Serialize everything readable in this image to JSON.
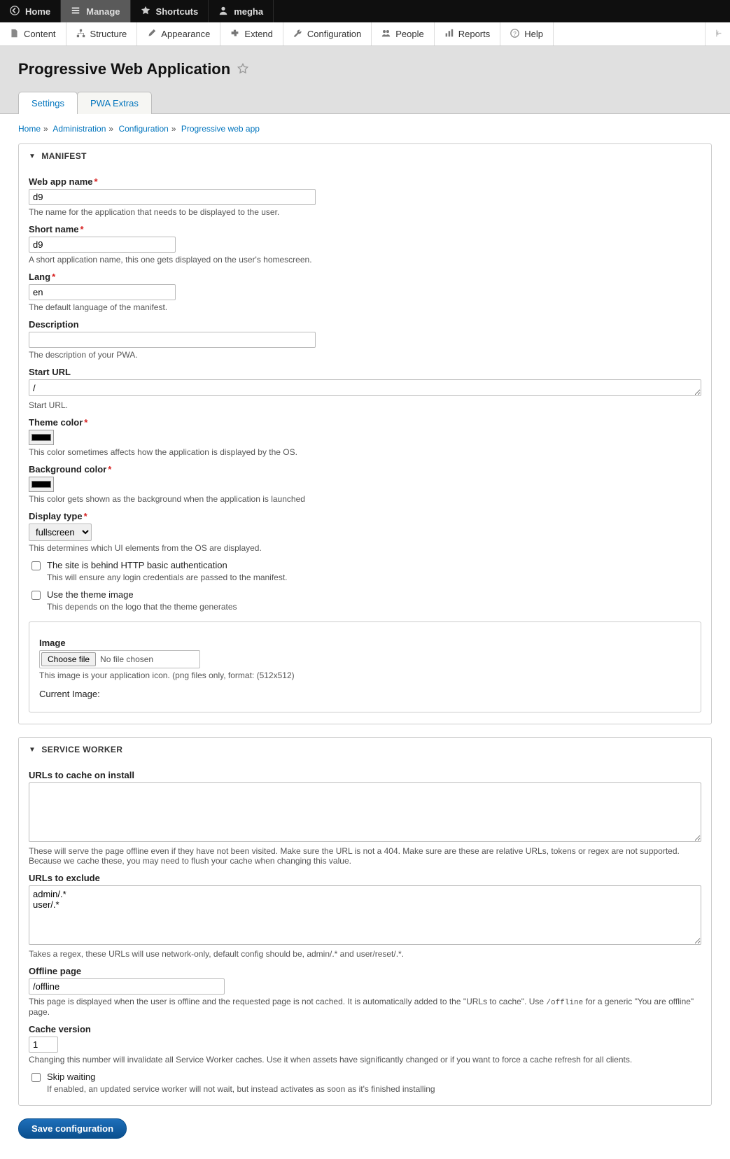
{
  "toolbar": {
    "home": "Home",
    "manage": "Manage",
    "shortcuts": "Shortcuts",
    "user": "megha"
  },
  "adminTabs": {
    "content": "Content",
    "structure": "Structure",
    "appearance": "Appearance",
    "extend": "Extend",
    "configuration": "Configuration",
    "people": "People",
    "reports": "Reports",
    "help": "Help"
  },
  "page": {
    "title": "Progressive Web Application"
  },
  "localTabs": {
    "settings": "Settings",
    "extras": "PWA Extras"
  },
  "breadcrumb": {
    "home": "Home",
    "admin": "Administration",
    "config": "Configuration",
    "pwa": "Progressive web app"
  },
  "manifest": {
    "legend": "Manifest",
    "webAppName": {
      "label": "Web app name",
      "value": "d9",
      "help": "The name for the application that needs to be displayed to the user."
    },
    "shortName": {
      "label": "Short name",
      "value": "d9",
      "help": "A short application name, this one gets displayed on the user's homescreen."
    },
    "lang": {
      "label": "Lang",
      "value": "en",
      "help": "The default language of the manifest."
    },
    "description": {
      "label": "Description",
      "value": "",
      "help": "The description of your PWA."
    },
    "startUrl": {
      "label": "Start URL",
      "value": "/",
      "help": "Start URL."
    },
    "themeColor": {
      "label": "Theme color",
      "value": "#000000",
      "help": "This color sometimes affects how the application is displayed by the OS."
    },
    "bgColor": {
      "label": "Background color",
      "value": "#000000",
      "help": "This color gets shown as the background when the application is launched"
    },
    "displayType": {
      "label": "Display type",
      "value": "fullscreen",
      "help": "This determines which UI elements from the OS are displayed."
    },
    "basicAuth": {
      "label": "The site is behind HTTP basic authentication",
      "help": "This will ensure any login credentials are passed to the manifest."
    },
    "useThemeImage": {
      "label": "Use the theme image",
      "help": "This depends on the logo that the theme generates"
    },
    "image": {
      "label": "Image",
      "choose": "Choose file",
      "noFile": "No file chosen",
      "help": "This image is your application icon. (png files only, format: (512x512)",
      "current": "Current Image:"
    }
  },
  "sw": {
    "legend": "Service worker",
    "cacheUrls": {
      "label": "URLs to cache on install",
      "value": "",
      "help": "These will serve the page offline even if they have not been visited. Make sure the URL is not a 404. Make sure are these are relative URLs, tokens or regex are not supported. Because we cache these, you may need to flush your cache when changing this value."
    },
    "excludeUrls": {
      "label": "URLs to exclude",
      "value": "admin/.*\nuser/.*",
      "help": "Takes a regex, these URLs will use network-only, default config should be, admin/.* and user/reset/.*."
    },
    "offlinePage": {
      "label": "Offline page",
      "value": "/offline",
      "helpPre": "This page is displayed when the user is offline and the requested page is not cached. It is automatically added to the \"URLs to cache\". Use ",
      "helpCode": "/offline",
      "helpPost": " for a generic \"You are offline\" page."
    },
    "cacheVersion": {
      "label": "Cache version",
      "value": "1",
      "help": "Changing this number will invalidate all Service Worker caches. Use it when assets have significantly changed or if you want to force a cache refresh for all clients."
    },
    "skipWaiting": {
      "label": "Skip waiting",
      "help": "If enabled, an updated service worker will not wait, but instead activates as soon as it's finished installing"
    }
  },
  "actions": {
    "save": "Save configuration"
  }
}
